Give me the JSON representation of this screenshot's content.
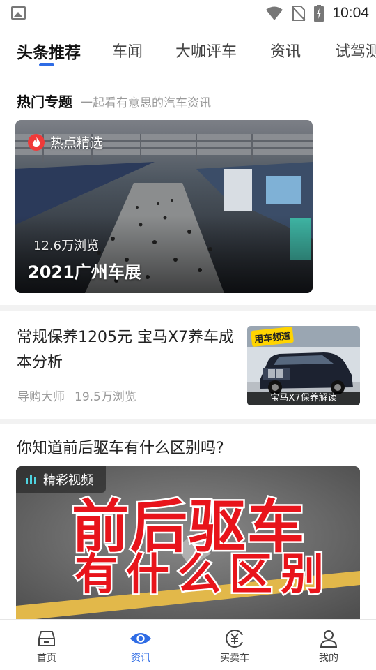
{
  "status_bar": {
    "time": "10:04"
  },
  "tabs": [
    {
      "label": "头条推荐",
      "active": true
    },
    {
      "label": "车闻",
      "active": false
    },
    {
      "label": "大咖评车",
      "active": false
    },
    {
      "label": "资讯",
      "active": false
    },
    {
      "label": "试驾测",
      "active": false
    }
  ],
  "hot_topics": {
    "title": "热门专题",
    "subtitle": "一起看有意思的汽车资讯",
    "card": {
      "badge": "热点精选",
      "views": "12.6万浏览",
      "title": "2021广州车展"
    }
  },
  "article": {
    "title": "常规保养1205元 宝马X7养车成本分析",
    "author": "导购大师",
    "views": "19.5万浏览",
    "thumbnail_tag": "用车频道",
    "thumbnail_caption": "宝马X7保养解读"
  },
  "video": {
    "title": "你知道前后驱车有什么区别吗?",
    "badge": "精彩视频",
    "overlay_line1": "前后驱车",
    "overlay_line2": "有什么区别"
  },
  "bottom_nav": [
    {
      "label": "首页",
      "icon": "car-home-icon",
      "active": false
    },
    {
      "label": "资讯",
      "icon": "eye-icon",
      "active": true
    },
    {
      "label": "买卖车",
      "icon": "yen-coin-icon",
      "active": false
    },
    {
      "label": "我的",
      "icon": "person-icon",
      "active": false
    }
  ],
  "colors": {
    "accent": "#2f6ce5",
    "hot": "#f03a3a"
  }
}
